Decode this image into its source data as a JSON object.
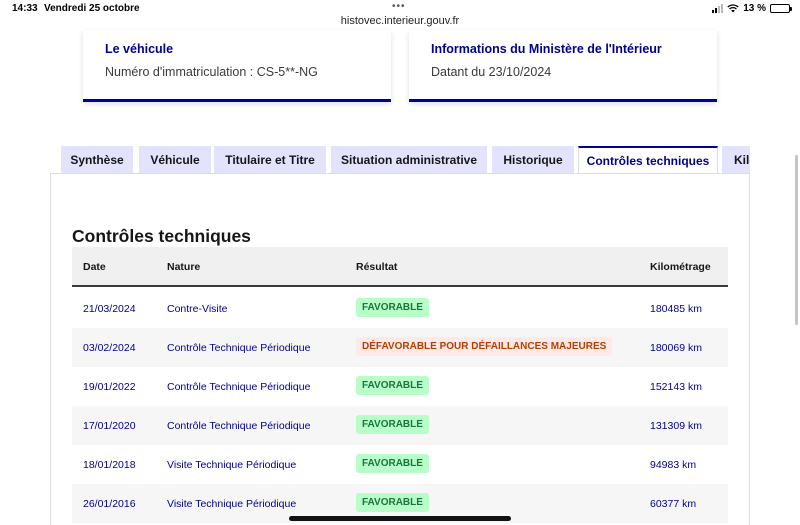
{
  "status_bar": {
    "time": "14:33",
    "date": "Vendredi 25 octobre",
    "url": "histovec.interieur.gouv.fr",
    "dots": "•••",
    "battery": "13 %",
    "battery_level": 0.13,
    "icons": [
      "signal-icon",
      "wifi-icon",
      "battery-icon"
    ]
  },
  "cards": [
    {
      "title": "Le véhicule",
      "text": "Numéro d'immatriculation : CS-5**-NG"
    },
    {
      "title": "Informations du Ministère de l'Intérieur",
      "text": "Datant du 23/10/2024"
    }
  ],
  "tabs": [
    {
      "label": "Synthèse",
      "active": false
    },
    {
      "label": "Véhicule",
      "active": false
    },
    {
      "label": "Titulaire et Titre",
      "active": false
    },
    {
      "label": "Situation administrative",
      "active": false
    },
    {
      "label": "Historique",
      "active": false
    },
    {
      "label": "Contrôles techniques",
      "active": true
    },
    {
      "label": "Kilométrage",
      "active": false
    }
  ],
  "section": {
    "title": "Contrôles techniques",
    "columns": [
      "Date",
      "Nature",
      "Résultat",
      "Kilométrage"
    ],
    "rows": [
      {
        "date": "21/03/2024",
        "nature": "Contre-Visite",
        "result": "FAVORABLE",
        "status": "ok",
        "km": "180485 km"
      },
      {
        "date": "03/02/2024",
        "nature": "Contrôle Technique Périodique",
        "result": "DÉFAVORABLE POUR DÉFAILLANCES MAJEURES",
        "status": "ko",
        "km": "180069 km"
      },
      {
        "date": "19/01/2022",
        "nature": "Contrôle Technique Périodique",
        "result": "FAVORABLE",
        "status": "ok",
        "km": "152143 km"
      },
      {
        "date": "17/01/2020",
        "nature": "Contrôle Technique Périodique",
        "result": "FAVORABLE",
        "status": "ok",
        "km": "131309 km"
      },
      {
        "date": "18/01/2018",
        "nature": "Visite Technique Périodique",
        "result": "FAVORABLE",
        "status": "ok",
        "km": "94983 km"
      },
      {
        "date": "26/01/2016",
        "nature": "Visite Technique Périodique",
        "result": "FAVORABLE",
        "status": "ok",
        "km": "60377 km"
      }
    ]
  },
  "colors": {
    "primary": "#000091",
    "tab_bg": "#e3e3fd",
    "success_bg": "#b8fec9",
    "success_text": "#18753c",
    "error_bg": "#ffe9e6",
    "error_text": "#b34000"
  }
}
